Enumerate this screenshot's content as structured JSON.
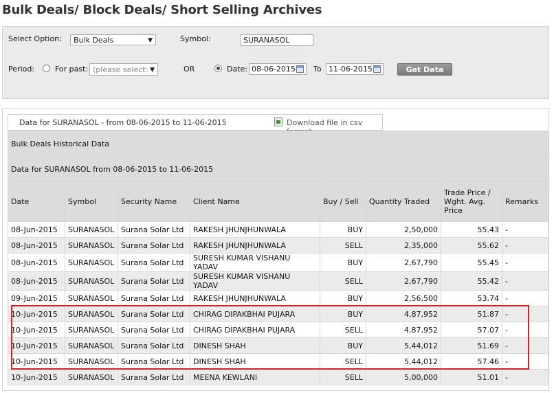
{
  "page": {
    "title": "Bulk Deals/ Block Deals/ Short Selling Archives"
  },
  "filters": {
    "select_option_label": "Select Option:",
    "select_option_value": "Bulk Deals",
    "symbol_label": "Symbol:",
    "symbol_value": "SURANASOL",
    "period_label": "Period:",
    "for_past_label": "For past:",
    "for_past_placeholder": "(please select:",
    "or_label": "OR",
    "date_label": "Date:",
    "from_date": "08-06-2015",
    "to_label": "To",
    "to_date": "11-06-2015",
    "get_data_label": "Get Data"
  },
  "results": {
    "info_text": "Data for SURANASOL - from 08-06-2015 to 11-06-2015",
    "download_label": "Download file in csv format",
    "section_title": "Bulk Deals Historical Data",
    "sub_title": "Data for SURANASOL from 08-06-2015 to 11-06-2015",
    "columns": [
      "Date",
      "Symbol",
      "Security Name",
      "Client Name",
      "Buy / Sell",
      "Quantity Traded",
      "Trade Price / Wght. Avg. Price",
      "Remarks"
    ],
    "rows": [
      [
        "08-Jun-2015",
        "SURANASOL",
        "Surana Solar Ltd",
        "RAKESH JHUNJHUNWALA",
        "BUY",
        "2,50,000",
        "55.43",
        "-"
      ],
      [
        "08-Jun-2015",
        "SURANASOL",
        "Surana Solar Ltd",
        "RAKESH JHUNJHUNWALA",
        "SELL",
        "2,35,000",
        "55.62",
        "-"
      ],
      [
        "08-Jun-2015",
        "SURANASOL",
        "Surana Solar Ltd",
        "SURESH KUMAR VISHANU YADAV",
        "BUY",
        "2,67,790",
        "55.45",
        "-"
      ],
      [
        "08-Jun-2015",
        "SURANASOL",
        "Surana Solar Ltd",
        "SURESH KUMAR VISHANU YADAV",
        "SELL",
        "2,67,790",
        "55.42",
        "-"
      ],
      [
        "09-Jun-2015",
        "SURANASOL",
        "Surana Solar Ltd",
        "RAKESH JHUNJHUNWALA",
        "BUY",
        "2,56,500",
        "53.74",
        "-"
      ],
      [
        "10-Jun-2015",
        "SURANASOL",
        "Surana Solar Ltd",
        "CHIRAG DIPAKBHAI PUJARA",
        "BUY",
        "4,87,952",
        "51.87",
        "-"
      ],
      [
        "10-Jun-2015",
        "SURANASOL",
        "Surana Solar Ltd",
        "CHIRAG DIPAKBHAI PUJARA",
        "SELL",
        "4,87,952",
        "57.07",
        "-"
      ],
      [
        "10-Jun-2015",
        "SURANASOL",
        "Surana Solar Ltd",
        "DINESH SHAH",
        "BUY",
        "5,44,012",
        "51.69",
        "-"
      ],
      [
        "10-Jun-2015",
        "SURANASOL",
        "Surana Solar Ltd",
        "DINESH SHAH",
        "SELL",
        "5,44,012",
        "57.46",
        "-"
      ],
      [
        "10-Jun-2015",
        "SURANASOL",
        "Surana Solar Ltd",
        "MEENA KEWLANI",
        "SELL",
        "5,00,000",
        "51.01",
        "-"
      ]
    ]
  },
  "colors": {
    "highlight": "#d8202a",
    "header_bg": "#dcdcdc",
    "alt_row_bg": "#ebebeb"
  },
  "icons": {
    "download": "csv-file-icon",
    "calendar": "calendar-icon",
    "dropdown": "chevron-down-icon"
  }
}
